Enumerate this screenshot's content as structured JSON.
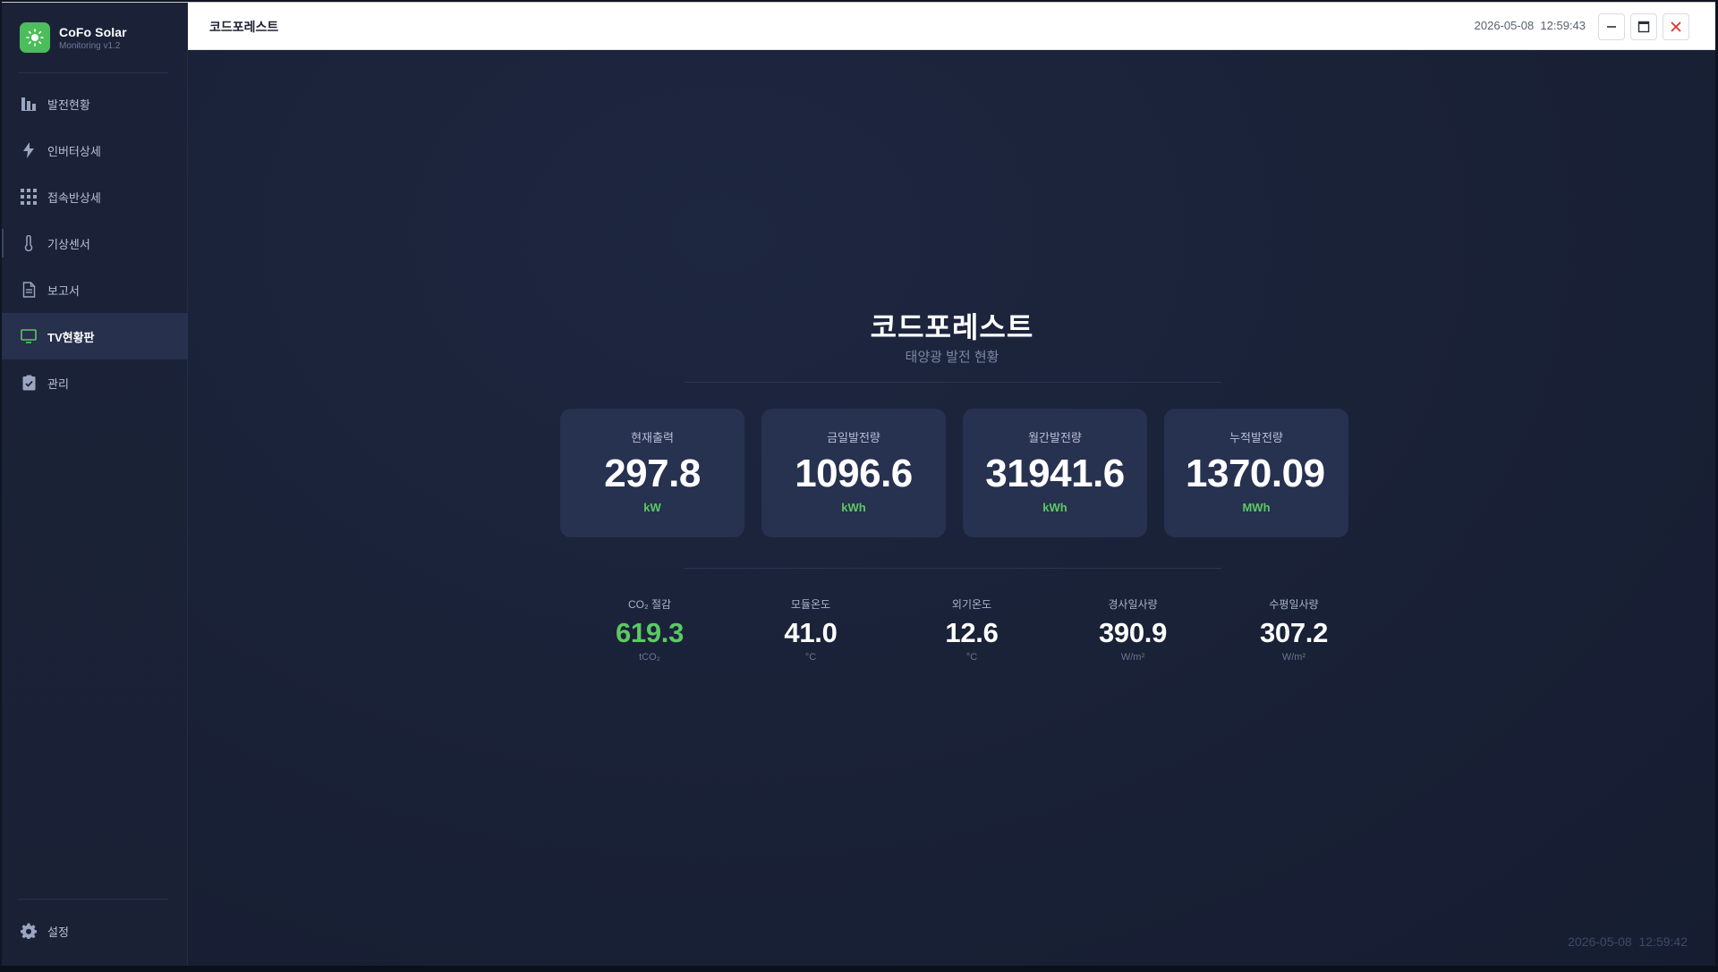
{
  "brand": {
    "name": "CoFo Solar",
    "version": "Monitoring v1.2"
  },
  "sidebar": {
    "items": [
      {
        "label": "발전현황",
        "icon": "bar-chart-icon"
      },
      {
        "label": "인버터상세",
        "icon": "lightning-icon"
      },
      {
        "label": "접속반상세",
        "icon": "grid-icon"
      },
      {
        "label": "기상센서",
        "icon": "thermometer-icon"
      },
      {
        "label": "보고서",
        "icon": "document-icon"
      },
      {
        "label": "TV현황판",
        "icon": "monitor-icon",
        "active": true
      },
      {
        "label": "관리",
        "icon": "clipboard-check-icon"
      }
    ],
    "settings_label": "설정"
  },
  "topbar": {
    "title": "코드포레스트",
    "datetime": "2026-05-08  12:59:43"
  },
  "main": {
    "site_title": "코드포레스트",
    "site_subtitle": "태양광 발전 현황",
    "cards": [
      {
        "label": "현재출력",
        "value": "297.8",
        "unit": "kW"
      },
      {
        "label": "금일발전량",
        "value": "1096.6",
        "unit": "kWh"
      },
      {
        "label": "월간발전량",
        "value": "31941.6",
        "unit": "kWh"
      },
      {
        "label": "누적발전량",
        "value": "1370.09",
        "unit": "MWh"
      }
    ],
    "stats": [
      {
        "label": "CO₂ 절감",
        "value": "619.3",
        "unit": "tCO₂"
      },
      {
        "label": "모듈온도",
        "value": "41.0",
        "unit": "°C"
      },
      {
        "label": "외기온도",
        "value": "12.6",
        "unit": "°C"
      },
      {
        "label": "경사일사량",
        "value": "390.9",
        "unit": "W/m²"
      },
      {
        "label": "수평일사량",
        "value": "307.2",
        "unit": "W/m²"
      }
    ],
    "footer_datetime": "2026-05-08  12:59:42"
  },
  "colors": {
    "accent": "#5cc963",
    "background": "#1a2238",
    "card": "#273150",
    "close": "#e0322f"
  }
}
